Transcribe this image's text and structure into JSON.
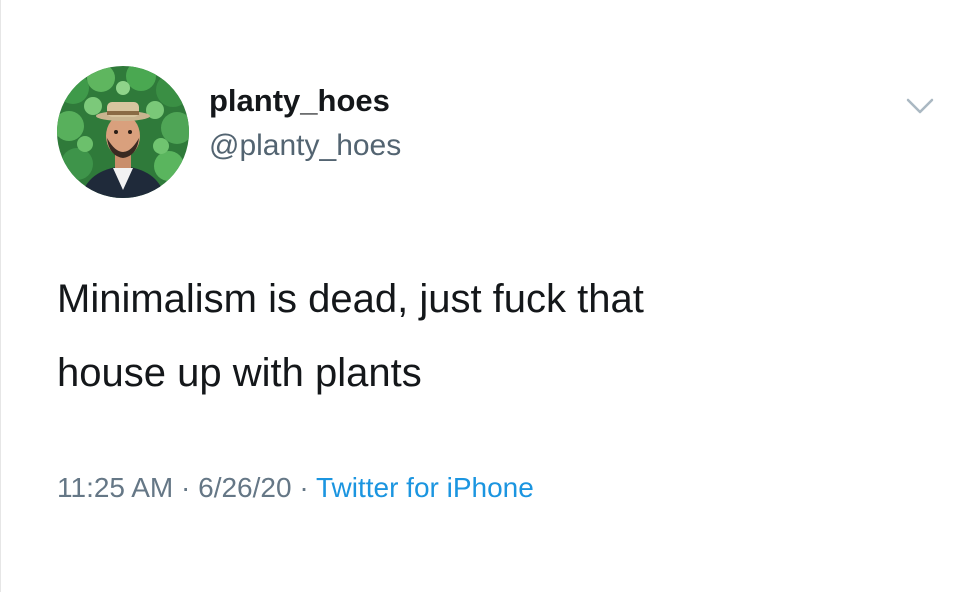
{
  "user": {
    "display_name": "planty_hoes",
    "handle": "@planty_hoes"
  },
  "tweet": {
    "text_line1": "Minimalism is dead, just fuck that",
    "text_line2": "house up with plants",
    "time": "11:25 AM",
    "separator1": " · ",
    "date": "6/26/20",
    "separator2": " · ",
    "source": "Twitter for iPhone"
  },
  "icons": {
    "menu": "chevron-down-icon"
  },
  "colors": {
    "source_link": "#1b95e0",
    "meta_text": "#657786",
    "text": "#14171a"
  }
}
